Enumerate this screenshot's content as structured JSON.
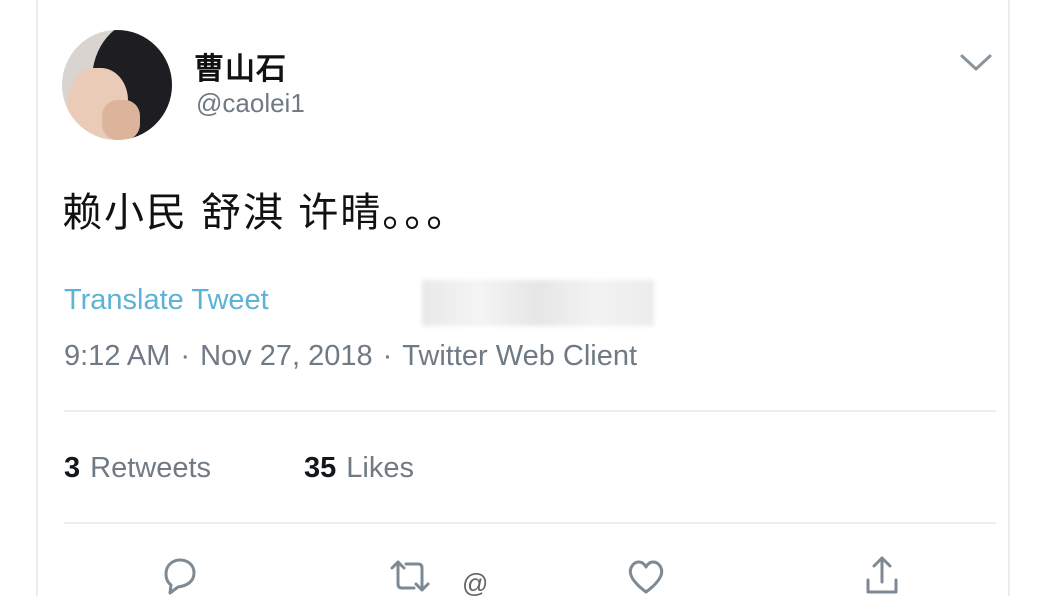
{
  "tweet": {
    "display_name": "曹山石",
    "handle": "@caolei1",
    "text": "赖小民 舒淇 许晴。。。",
    "translate_label": "Translate Tweet",
    "time": "9:12 AM",
    "date": "Nov 27, 2018",
    "client": "Twitter Web Client",
    "separator": "·"
  },
  "stats": {
    "retweets_count": "3",
    "retweets_label": "Retweets",
    "likes_count": "35",
    "likes_label": "Likes"
  },
  "icons": {
    "menu": "chevron-down-icon",
    "reply": "reply-icon",
    "retweet": "retweet-icon",
    "like": "heart-icon",
    "share": "share-icon"
  },
  "watermark": "@"
}
